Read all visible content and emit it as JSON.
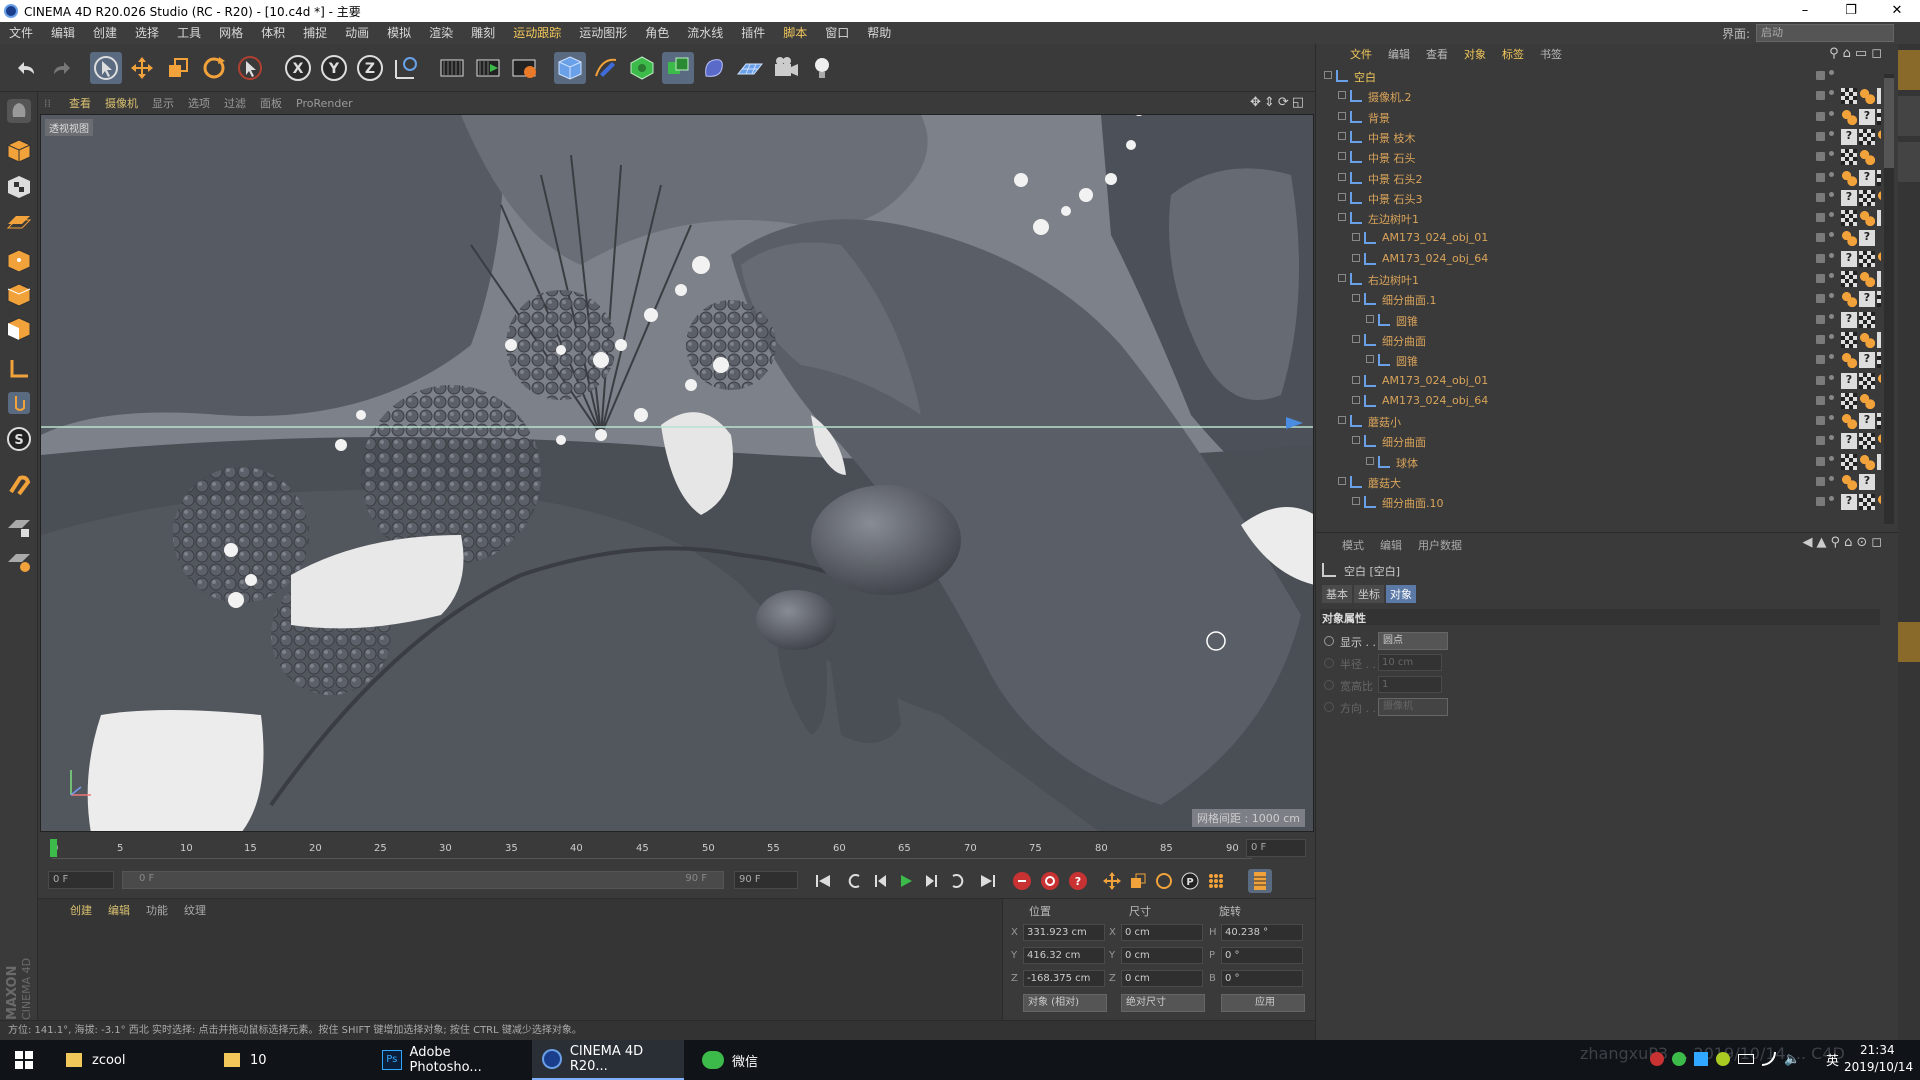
{
  "window": {
    "title": "CINEMA 4D R20.026 Studio (RC - R20) - [10.c4d *] - 主要",
    "controls": [
      "–",
      "❐",
      "✕"
    ]
  },
  "menubar": {
    "items": [
      "文件",
      "编辑",
      "创建",
      "选择",
      "工具",
      "网格",
      "体积",
      "捕捉",
      "动画",
      "模拟",
      "渲染",
      "雕刻",
      "运动跟踪",
      "运动图形",
      "角色",
      "流水线",
      "插件",
      "脚本",
      "窗口",
      "帮助"
    ],
    "layout_label": "界面:",
    "layout_value": "启动"
  },
  "viewport": {
    "menu": [
      "查看",
      "摄像机",
      "显示",
      "选项",
      "过滤",
      "面板",
      "ProRender"
    ],
    "label": "透视视图",
    "grid_spacing": "网格间距 : 1000 cm"
  },
  "timeline": {
    "ticks": [
      "0",
      "5",
      "10",
      "15",
      "20",
      "25",
      "30",
      "35",
      "40",
      "45",
      "50",
      "55",
      "60",
      "65",
      "70",
      "75",
      "80",
      "85",
      "90"
    ],
    "current_frame": "0 F"
  },
  "transport": {
    "start": "0 F",
    "range_start": "0 F",
    "range_end": "90 F",
    "end": "90 F"
  },
  "material_panel": {
    "menu": [
      "创建",
      "编辑",
      "功能",
      "纹理"
    ],
    "brand": "MAXON CINEMA 4D"
  },
  "coords": {
    "headers": [
      "位置",
      "尺寸",
      "旋转"
    ],
    "rows": [
      {
        "axis": "X",
        "pos": "331.923 cm",
        "size": "0 cm",
        "rot_axis": "H",
        "rot": "40.238 °"
      },
      {
        "axis": "Y",
        "pos": "416.32 cm",
        "size": "0 cm",
        "rot_axis": "P",
        "rot": "0 °"
      },
      {
        "axis": "Z",
        "pos": "-168.375 cm",
        "size": "0 cm",
        "rot_axis": "B",
        "rot": "0 °"
      }
    ],
    "mode": "对象 (相对)",
    "size_mode": "绝对尺寸",
    "apply": "应用"
  },
  "status": "方位: 141.1°, 海拔: -3.1° 西北    实时选择: 点击并拖动鼠标选择元素。按住 SHIFT 键增加选择对象; 按住 CTRL 键减少选择对象。",
  "object_manager": {
    "menu": [
      "文件",
      "编辑",
      "查看",
      "对象",
      "标签",
      "书签"
    ],
    "objects": [
      {
        "name": "空白",
        "indent": 0,
        "color": "#f2c85b"
      },
      {
        "name": "摄像机.2",
        "indent": 1,
        "color": "#d9a45a"
      },
      {
        "name": "背景",
        "indent": 1,
        "color": "#d9a45a"
      },
      {
        "name": "中景 枝木",
        "indent": 1,
        "color": "#d9a45a"
      },
      {
        "name": "中景 石头",
        "indent": 1,
        "color": "#d9a45a"
      },
      {
        "name": "中景 石头2",
        "indent": 1,
        "color": "#d9a45a"
      },
      {
        "name": "中景 石头3",
        "indent": 1,
        "color": "#d9a45a"
      },
      {
        "name": "左边树叶1",
        "indent": 1,
        "color": "#d9a45a"
      },
      {
        "name": "AM173_024_obj_01",
        "indent": 2,
        "color": "#d9a45a"
      },
      {
        "name": "AM173_024_obj_64",
        "indent": 2,
        "color": "#d9a45a"
      },
      {
        "name": "右边树叶1",
        "indent": 1,
        "color": "#d9a45a"
      },
      {
        "name": "细分曲面.1",
        "indent": 2,
        "color": "#d9a45a"
      },
      {
        "name": "圆锥",
        "indent": 3,
        "color": "#d9a45a"
      },
      {
        "name": "细分曲面",
        "indent": 2,
        "color": "#d9a45a"
      },
      {
        "name": "圆锥",
        "indent": 3,
        "color": "#d9a45a"
      },
      {
        "name": "AM173_024_obj_01",
        "indent": 2,
        "color": "#d9a45a"
      },
      {
        "name": "AM173_024_obj_64",
        "indent": 2,
        "color": "#d9a45a"
      },
      {
        "name": "蘑菇小",
        "indent": 1,
        "color": "#d9a45a"
      },
      {
        "name": "细分曲面",
        "indent": 2,
        "color": "#d9a45a"
      },
      {
        "name": "球体",
        "indent": 3,
        "color": "#d9a45a"
      },
      {
        "name": "蘑菇大",
        "indent": 1,
        "color": "#d9a45a"
      },
      {
        "name": "细分曲面.10",
        "indent": 2,
        "color": "#d9a45a"
      }
    ]
  },
  "attributes": {
    "menu": [
      "模式",
      "编辑",
      "用户数据"
    ],
    "object_title": "空白 [空白]",
    "tabs": [
      "基本",
      "坐标",
      "对象"
    ],
    "section": "对象属性",
    "props": [
      {
        "label": "显示 . . .",
        "value": "圆点",
        "enabled": true
      },
      {
        "label": "半径 . . .",
        "value": "10 cm",
        "enabled": false
      },
      {
        "label": "宽高比",
        "value": "1",
        "enabled": false
      },
      {
        "label": "方向 . . .",
        "value": "摄像机",
        "enabled": false
      }
    ]
  },
  "taskbar": {
    "items": [
      {
        "label": "zcool"
      },
      {
        "label": "10"
      },
      {
        "label": "Adobe Photosho..."
      },
      {
        "label": "CINEMA 4D R20..."
      },
      {
        "label": "微信"
      }
    ],
    "ime": "英",
    "time": "21:34",
    "date": "2019/10/14",
    "watermark": "zhangxuP3 ... 2019/10/14 ... C4D"
  }
}
